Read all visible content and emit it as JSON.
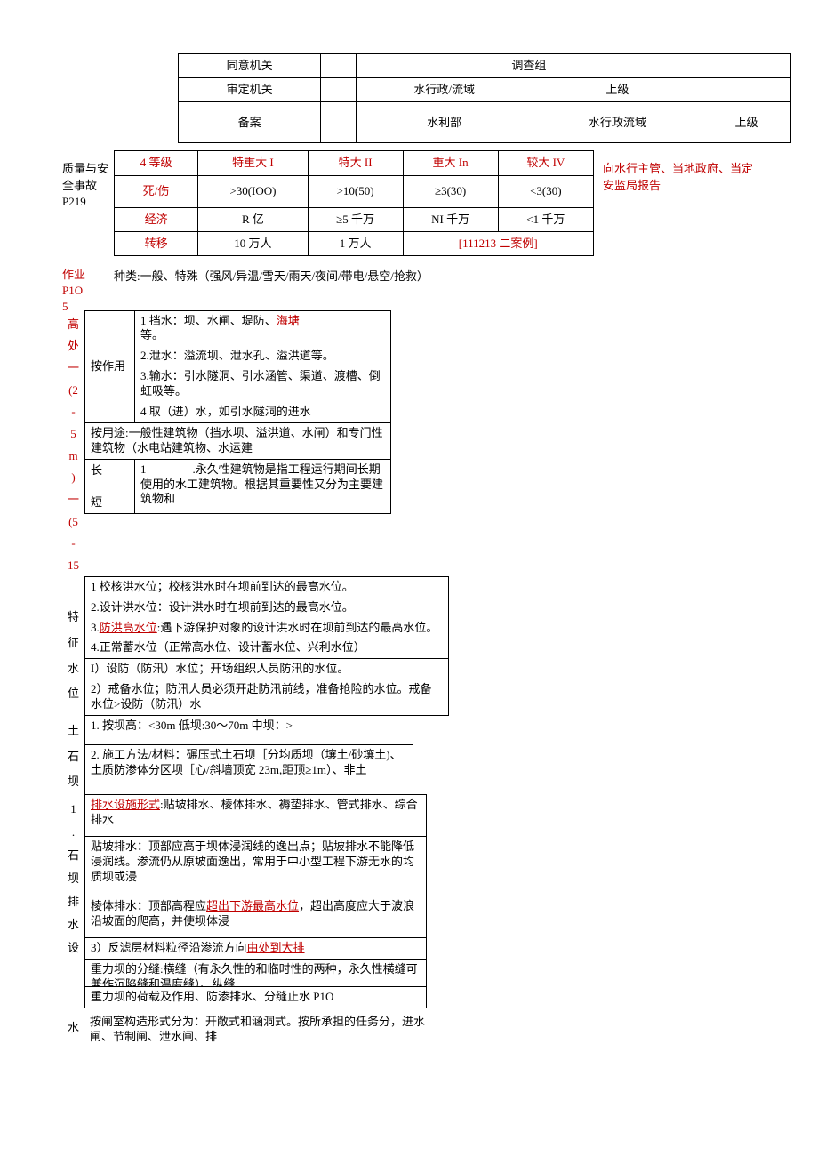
{
  "t1": {
    "r1": {
      "a": "同意机关",
      "b": "调查组"
    },
    "r2": {
      "a": "审定机关",
      "b": "水行政/流域",
      "c": "上级"
    },
    "r3": {
      "a": "备案",
      "b": "水利部",
      "c": "水行政流域",
      "d": "上级"
    }
  },
  "t2": {
    "side": "质量与安全事故 P219",
    "r1": {
      "a": "4 等级",
      "b": "特重大 I",
      "c": "特大 II",
      "d": "重大 In",
      "e": "较大 IV"
    },
    "r2": {
      "a": "死/伤",
      "b": ">30(IOO)",
      "c": ">10(50)",
      "d": "≥3(30)",
      "e": "<3(30)"
    },
    "r3": {
      "a": "经济",
      "b": "R 亿",
      "c": "≥5 千万",
      "d": "NI 千万",
      "e": "<1 千万"
    },
    "r4": {
      "a": "转移",
      "b": "10 万人",
      "c": "1 万人",
      "d": "[111213 二案例]"
    },
    "note": "向水行主管、当地政府、当定安监局报告"
  },
  "zy": {
    "label1": "作业",
    "label2": "P1O",
    "label3": "5",
    "text": "种类:一般、特殊（强风/异温/雪天/雨天/夜间/带电/悬空/抢救）"
  },
  "gaochu": {
    "col": "高处一(2-5m)一(5-15",
    "c1": "按作用",
    "l1a": "1 挡水：坝、水闸、堤防、",
    "l1b": "海塘",
    "l1c": "等。",
    "l2": "2.泄水：溢流坝、泄水孔、溢洪道等。",
    "l3": "3.输水：引水隧洞、引水涵管、渠道、渡槽、倒虹吸等。",
    "l4": "4 取（进）水，如引水隧洞的进水",
    "l5": "按用途:一般性建筑物（挡水坝、溢洪道、水闸）和专门性建筑物（水电站建筑物、水运建",
    "c2a": "长",
    "c2b": "短",
    "l6": "1　　　　.永久性建筑物是指工程运行期间长期使用的水工建筑物。根据其重要性又分为主要建筑物和"
  },
  "tezheng": {
    "col": "特征水位",
    "l1": "1 校核洪水位；校核洪水时在坝前到达的最高水位。",
    "l2": "2.设计洪水位：设计洪水时在坝前到达的最高水位。",
    "l3a": "3.",
    "l3b": "防洪高水位",
    "l3c": ":遇下游保护对象的设计洪水时在坝前到达的最高水位。",
    "l4": "4.正常蓄水位（正常高水位、设计蓄水位、兴利水位）",
    "l5": "I）设防（防汛）水位；开场组织人员防汛的水位。",
    "l6": "2）戒备水位；防汛人员必须开赴防汛前线，准备抢险的水位。戒备水位>设防（防汛）水"
  },
  "tushi": {
    "col": "土石坝",
    "l1": "1. 按坝高：<30m 低坝:30～70m 中坝：>",
    "l2": "2. 施工方法/材料：碾压式土石坝［分均质坝（壤土/砂壤土)、土质防渗体分区坝［心/斜墙顶宽 23m,距顶≥1m）、非土"
  },
  "paishui": {
    "col": "1.石坝排水设",
    "l1a": "排水设施形式",
    "l1b": ":贴坡排水、棱体排水、褥垫排水、管式排水、综合排水",
    "l2": "贴坡排水：顶部应高于坝体浸润线的逸出点；贴坡排水不能降低浸润线。渗流仍从原坡面逸出，常用于中小型工程下游无水的均质坝或浸",
    "l3a": "棱体排水：顶部高程应",
    "l3b": "超出下游最高水位",
    "l3c": "，超出高度应大于波浪沿坡面的爬高，并使坝体浸",
    "l4a": "3）反滤层材料粒径沿渗流方向",
    "l4b": "由处到大排"
  },
  "zhongli": {
    "b1": "重力坝的分缝:横缝（有永久性的和临时性的两种，永久性横缝可兼作沉陷缝和温度缝）、纵缝",
    "b2": "重力坝的荷载及作用、防渗排水、分缝止水 P1O"
  },
  "shuizha": {
    "col": "水",
    "text": "按闸室构造形式分为：开敞式和涵洞式。按所承担的任务分，进水闸、节制闸、泄水闸、排"
  }
}
